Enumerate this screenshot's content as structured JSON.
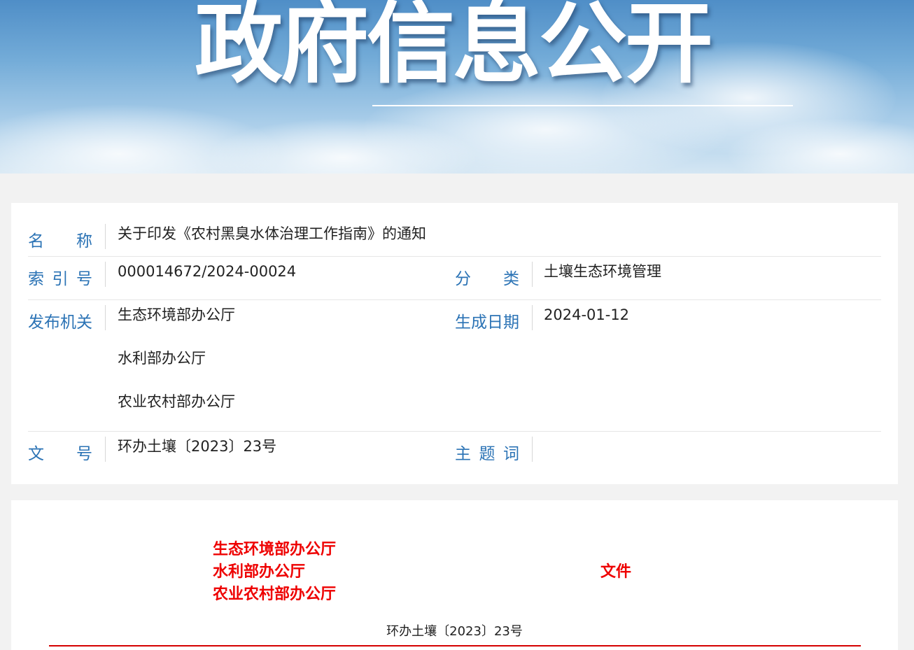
{
  "banner": {
    "title": "政府信息公开"
  },
  "info": {
    "name": {
      "label_chars": [
        "名",
        "称"
      ],
      "value": "关于印发《农村黑臭水体治理工作指南》的通知"
    },
    "index": {
      "label_chars": [
        "索",
        "引",
        "号"
      ],
      "value": "000014672/2024-00024"
    },
    "category": {
      "label_chars": [
        "分",
        "类"
      ],
      "value": "土壤生态环境管理"
    },
    "publisher": {
      "label_chars": [
        "发",
        "布",
        "机",
        "关"
      ],
      "values": [
        "生态环境部办公厅",
        "水利部办公厅",
        "农业农村部办公厅"
      ]
    },
    "date": {
      "label_chars": [
        "生",
        "成",
        "日",
        "期"
      ],
      "value": "2024-01-12"
    },
    "doc_no": {
      "label_chars": [
        "文",
        "号"
      ],
      "value": "环办土壤〔2023〕23号"
    },
    "keywords": {
      "label_chars": [
        "主",
        "题",
        "词"
      ],
      "value": ""
    }
  },
  "document": {
    "issuers": [
      "生态环境部办公厅",
      "水利部办公厅",
      "农业农村部办公厅"
    ],
    "suffix": "文件",
    "number": "环办土壤〔2023〕23号"
  },
  "colors": {
    "label_blue": "#2b73b5",
    "header_red": "#ee0000",
    "rule_red": "#d40000",
    "page_bg": "#f2f2f2"
  }
}
